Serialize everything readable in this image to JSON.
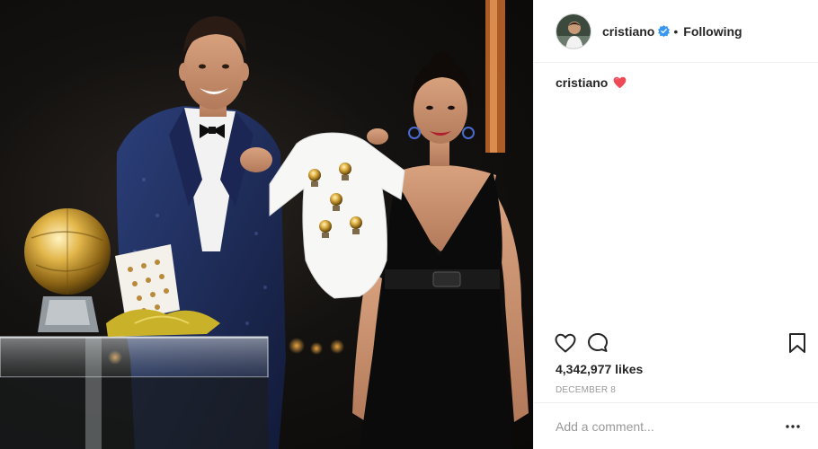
{
  "post": {
    "username": "cristiano",
    "separator": "•",
    "follow_status": "Following",
    "verified": true,
    "caption": {
      "username": "cristiano",
      "emoji": "heart"
    },
    "likes": "4,342,977 likes",
    "date": "DECEMBER 8",
    "comment_placeholder": "Add a comment...",
    "more_label": "•••"
  },
  "icons": {
    "verified": "verified-badge-icon",
    "heart_emoji": "red-heart-icon",
    "like": "heart-outline-icon",
    "comment": "speech-bubble-icon",
    "save": "bookmark-icon",
    "more": "more-options-icon"
  },
  "colors": {
    "verified_blue": "#3897f0",
    "heart_red": "#ed4956",
    "text": "#262626",
    "muted": "#999999",
    "border": "#efefef"
  }
}
